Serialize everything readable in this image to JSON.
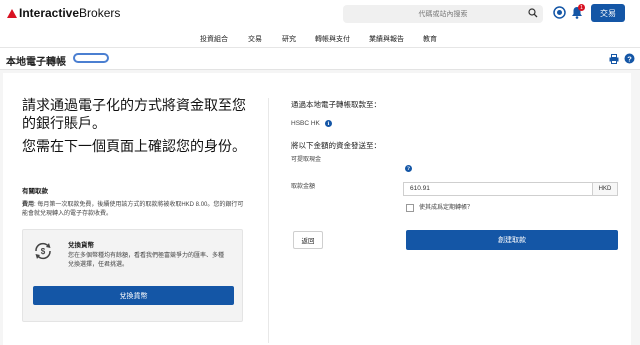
{
  "header": {
    "logo_bold": "Interactive",
    "logo_rest": "Brokers",
    "search_placeholder": "代碼或站內搜索",
    "notification_count": "1",
    "trade_button": "交易"
  },
  "nav": {
    "items": [
      "投資組合",
      "交易",
      "研究",
      "轉帳與支付",
      "業績與報告",
      "教育"
    ]
  },
  "page": {
    "title": "本地電子轉帳"
  },
  "left": {
    "heading1": "請求通過電子化的方式將資金取至您的銀行賬戶。",
    "heading2": "您需在下一個頁面上確認您的身份。",
    "about_title": "有關取款",
    "fee_label": "費用",
    "fee_text": ": 每月第一次取款免費，後續使用該方式的取款將被收取HKD 8.00。您的銀行可能會就兌現轉入的電子存款收費。",
    "exchange": {
      "title": "兌換貨幣",
      "text": "您在多個幣種均有餘額，看看我們極富競爭力的匯率、多種兌換選擇，任君挑選。",
      "button": "兌換貨幣"
    }
  },
  "right": {
    "dest_label": "通過本地電子轉帳取款至：",
    "bank_name": "HSBC HK",
    "send_label": "將以下金額的資金發送至：",
    "withdrawable_label": "可提取現金",
    "amount_label": "取款金額",
    "amount_value": "610.91",
    "currency": "HKD",
    "recurring_label": "使其成爲定期轉帳？",
    "back_button": "返回",
    "create_button": "創建取款"
  },
  "colors": {
    "brand_blue": "#1456a6",
    "logo_red": "#d81222"
  }
}
